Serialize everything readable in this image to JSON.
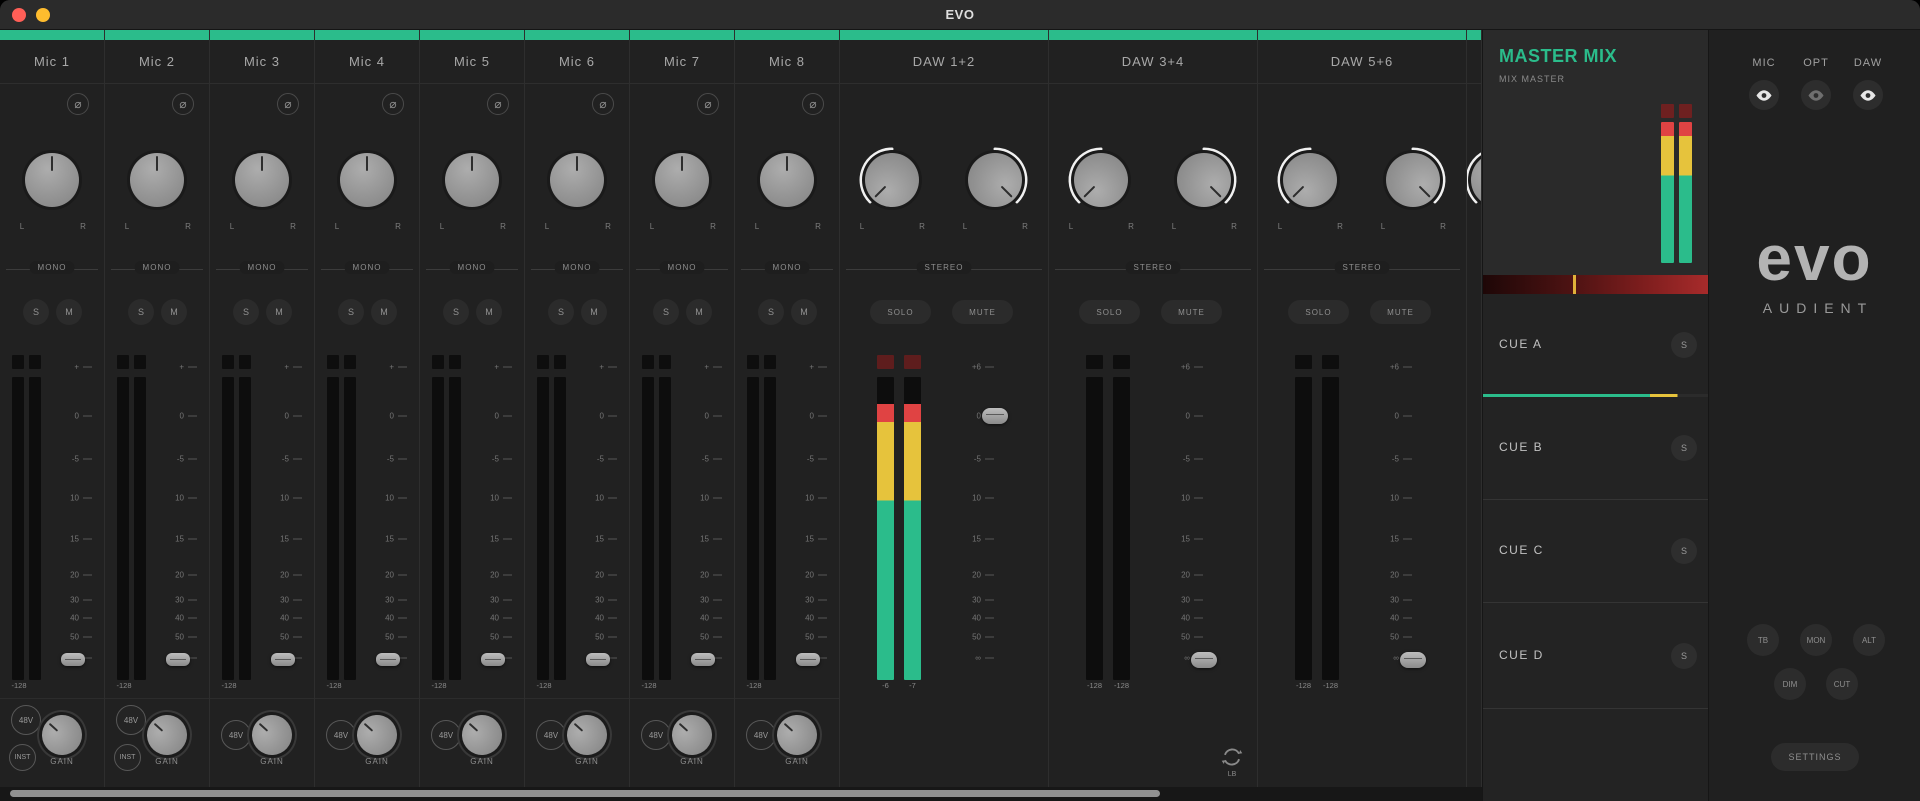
{
  "window": {
    "title": "EVO"
  },
  "channels": [
    {
      "kind": "mono",
      "name": "Mic 1",
      "phase": "⌀",
      "pan_l": "L",
      "pan_r": "R",
      "mode": "MONO",
      "solo": "S",
      "mute": "M",
      "scale": [
        "+",
        "0",
        "-5",
        "10",
        "15",
        "20",
        "30",
        "40",
        "50",
        "∞"
      ],
      "level": "-128",
      "phantom": "48V",
      "inst": "INST",
      "gain": "GAIN",
      "fader": "bottom",
      "lit": false
    },
    {
      "kind": "mono",
      "name": "Mic 2",
      "phase": "⌀",
      "pan_l": "L",
      "pan_r": "R",
      "mode": "MONO",
      "solo": "S",
      "mute": "M",
      "scale": [
        "+",
        "0",
        "-5",
        "10",
        "15",
        "20",
        "30",
        "40",
        "50",
        "∞"
      ],
      "level": "-128",
      "phantom": "48V",
      "inst": "INST",
      "gain": "GAIN",
      "fader": "bottom",
      "lit": false
    },
    {
      "kind": "mono",
      "name": "Mic 3",
      "phase": "⌀",
      "pan_l": "L",
      "pan_r": "R",
      "mode": "MONO",
      "solo": "S",
      "mute": "M",
      "scale": [
        "+",
        "0",
        "-5",
        "10",
        "15",
        "20",
        "30",
        "40",
        "50",
        "∞"
      ],
      "level": "-128",
      "phantom": "48V",
      "inst": null,
      "gain": "GAIN",
      "fader": "bottom",
      "lit": false
    },
    {
      "kind": "mono",
      "name": "Mic 4",
      "phase": "⌀",
      "pan_l": "L",
      "pan_r": "R",
      "mode": "MONO",
      "solo": "S",
      "mute": "M",
      "scale": [
        "+",
        "0",
        "-5",
        "10",
        "15",
        "20",
        "30",
        "40",
        "50",
        "∞"
      ],
      "level": "-128",
      "phantom": "48V",
      "inst": null,
      "gain": "GAIN",
      "fader": "bottom",
      "lit": false
    },
    {
      "kind": "mono",
      "name": "Mic 5",
      "phase": "⌀",
      "pan_l": "L",
      "pan_r": "R",
      "mode": "MONO",
      "solo": "S",
      "mute": "M",
      "scale": [
        "+",
        "0",
        "-5",
        "10",
        "15",
        "20",
        "30",
        "40",
        "50",
        "∞"
      ],
      "level": "-128",
      "phantom": "48V",
      "inst": null,
      "gain": "GAIN",
      "fader": "bottom",
      "lit": false
    },
    {
      "kind": "mono",
      "name": "Mic 6",
      "phase": "⌀",
      "pan_l": "L",
      "pan_r": "R",
      "mode": "MONO",
      "solo": "S",
      "mute": "M",
      "scale": [
        "+",
        "0",
        "-5",
        "10",
        "15",
        "20",
        "30",
        "40",
        "50",
        "∞"
      ],
      "level": "-128",
      "phantom": "48V",
      "inst": null,
      "gain": "GAIN",
      "fader": "bottom",
      "lit": false
    },
    {
      "kind": "mono",
      "name": "Mic 7",
      "phase": "⌀",
      "pan_l": "L",
      "pan_r": "R",
      "mode": "MONO",
      "solo": "S",
      "mute": "M",
      "scale": [
        "+",
        "0",
        "-5",
        "10",
        "15",
        "20",
        "30",
        "40",
        "50",
        "∞"
      ],
      "level": "-128",
      "phantom": "48V",
      "inst": null,
      "gain": "GAIN",
      "fader": "bottom",
      "lit": false
    },
    {
      "kind": "mono",
      "name": "Mic 8",
      "phase": "⌀",
      "pan_l": "L",
      "pan_r": "R",
      "mode": "MONO",
      "solo": "S",
      "mute": "M",
      "scale": [
        "+",
        "0",
        "-5",
        "10",
        "15",
        "20",
        "30",
        "40",
        "50",
        "∞"
      ],
      "level": "-128",
      "phantom": "48V",
      "inst": null,
      "gain": "GAIN",
      "fader": "bottom",
      "lit": false
    },
    {
      "kind": "stereo",
      "name": "DAW 1+2",
      "pan_l": "L",
      "pan_r": "R",
      "mode": "STEREO",
      "solo": "SOLO",
      "mute": "MUTE",
      "scale": [
        "+6",
        "0",
        "-5",
        "10",
        "15",
        "20",
        "30",
        "40",
        "50",
        "∞"
      ],
      "level_l": "-6",
      "level_r": "-7",
      "fader": "zero",
      "lit": true,
      "loopback": null
    },
    {
      "kind": "stereo",
      "name": "DAW 3+4",
      "pan_l": "L",
      "pan_r": "R",
      "mode": "STEREO",
      "solo": "SOLO",
      "mute": "MUTE",
      "scale": [
        "+6",
        "0",
        "-5",
        "10",
        "15",
        "20",
        "30",
        "40",
        "50",
        "∞"
      ],
      "level_l": "-128",
      "level_r": "-128",
      "fader": "bottom",
      "lit": false,
      "loopback": "LB"
    },
    {
      "kind": "stereo",
      "name": "DAW 5+6",
      "pan_l": "L",
      "pan_r": "R",
      "mode": "STEREO",
      "solo": "SOLO",
      "mute": "MUTE",
      "scale": [
        "+6",
        "0",
        "-5",
        "10",
        "15",
        "20",
        "30",
        "40",
        "50",
        "∞"
      ],
      "level_l": "-128",
      "level_r": "-128",
      "fader": "bottom",
      "lit": false,
      "loopback": null
    },
    {
      "kind": "partial"
    }
  ],
  "master": {
    "title": "MASTER MIX",
    "subtitle": "MIX MASTER",
    "cues": [
      {
        "label": "CUE A",
        "solo": "S"
      },
      {
        "label": "CUE B",
        "solo": "S"
      },
      {
        "label": "CUE C",
        "solo": "S"
      },
      {
        "label": "CUE D",
        "solo": "S"
      }
    ]
  },
  "right_panel": {
    "inputs": [
      {
        "label": "MIC",
        "active": true
      },
      {
        "label": "OPT",
        "active": false
      },
      {
        "label": "DAW",
        "active": true
      }
    ],
    "logo": "evo",
    "brand": "AUDIENT",
    "monitor_buttons": [
      {
        "label": "TB"
      },
      {
        "label": "MON"
      },
      {
        "label": "ALT"
      }
    ],
    "dim_cut": [
      {
        "label": "DIM"
      },
      {
        "label": "CUT"
      }
    ],
    "settings": "SETTINGS"
  }
}
